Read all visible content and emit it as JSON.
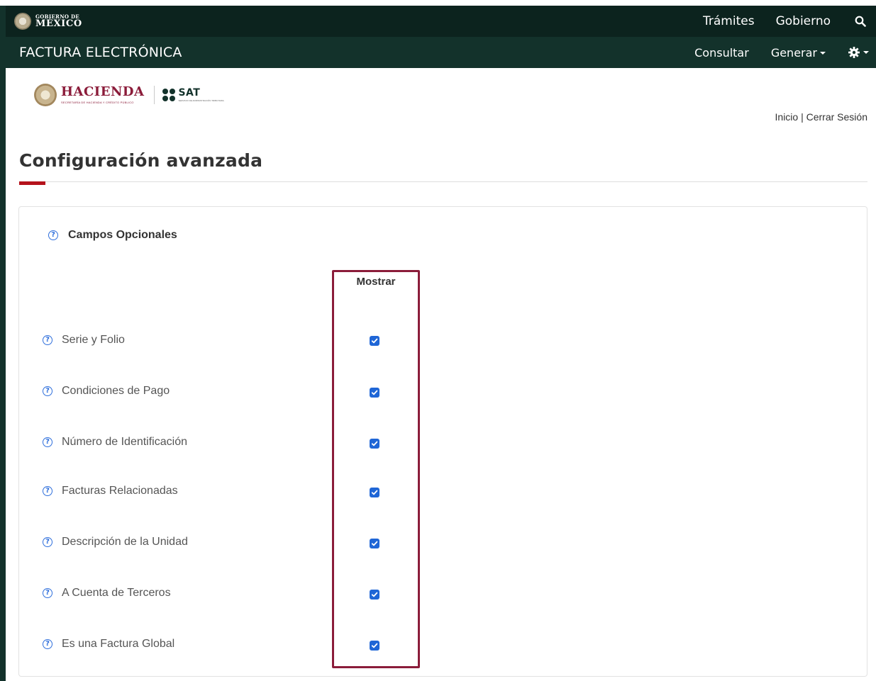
{
  "gov_bar": {
    "logo_small": "GOBIERNO DE",
    "logo_big": "MÉXICO",
    "links": [
      "Trámites",
      "Gobierno"
    ]
  },
  "app_bar": {
    "title": "FACTURA ELECTRÓNICA",
    "links": {
      "consultar": "Consultar",
      "generar": "Generar"
    }
  },
  "logos": {
    "hacienda": "HACIENDA",
    "hacienda_sub": "SECRETARÍA DE HACIENDA Y CRÉDITO PÚBLICO",
    "sat": "SAT",
    "sat_sub": "SERVICIO DE ADMINISTRACIÓN TRIBUTARIA"
  },
  "top_links": {
    "inicio": "Inicio",
    "separator": " | ",
    "cerrar": "Cerrar Sesión"
  },
  "page": {
    "title": "Configuración avanzada"
  },
  "panel": {
    "section_title": "Campos Opcionales",
    "column_header": "Mostrar",
    "fields": [
      {
        "label": "Serie y Folio",
        "checked": true
      },
      {
        "label": "Condiciones de Pago",
        "checked": true
      },
      {
        "label": "Número de Identificación",
        "checked": true
      },
      {
        "label": "Facturas Relacionadas",
        "checked": true
      },
      {
        "label": "Descripción de la Unidad",
        "checked": true
      },
      {
        "label": "A Cuenta de Terceros",
        "checked": true
      },
      {
        "label": "Es una Factura Global",
        "checked": true
      }
    ]
  },
  "colors": {
    "gov_bar": "#0c231e",
    "app_bar": "#13322b",
    "accent": "#b5121b",
    "highlight": "#8b1c3a",
    "checkbox": "#1f66d6",
    "help_icon": "#2f6fdc"
  },
  "icons": [
    "search-icon",
    "gear-icon",
    "help-icon",
    "check-icon"
  ]
}
